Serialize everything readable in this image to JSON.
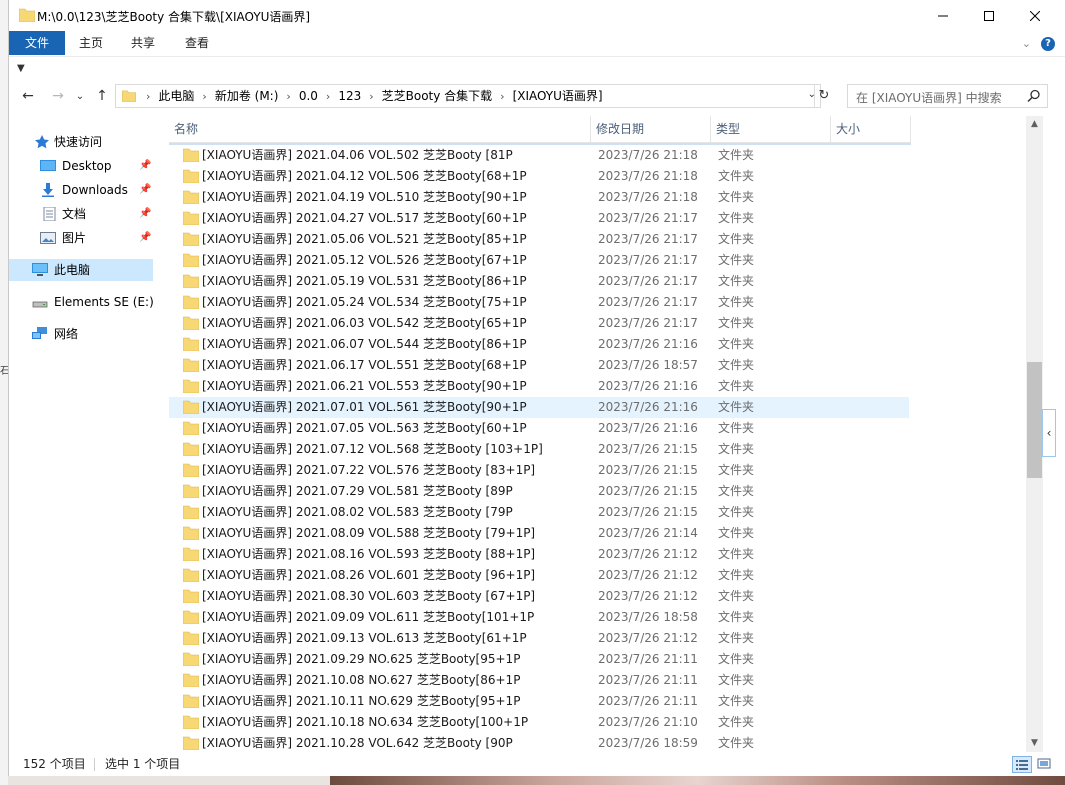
{
  "window": {
    "title": "M:\\0.0\\123\\芝芝Booty 合集下载\\[XIAOYU语画界]",
    "controls": {
      "minimize": "minimize",
      "maximize": "maximize",
      "close": "close"
    }
  },
  "ribbon": {
    "tabs": [
      "文件",
      "主页",
      "共享",
      "查看"
    ],
    "help": "?"
  },
  "address": {
    "crumbs": [
      "此电脑",
      "新加卷 (M:)",
      "0.0",
      "123",
      "芝芝Booty 合集下载",
      "[XIAOYU语画界]"
    ]
  },
  "search": {
    "placeholder": "在 [XIAOYU语画界] 中搜索"
  },
  "sidebar": {
    "items": [
      {
        "label": "快速访问",
        "icon": "star-icon"
      },
      {
        "label": "Desktop",
        "icon": "desktop-icon",
        "pinned": true
      },
      {
        "label": "Downloads",
        "icon": "download-icon",
        "pinned": true
      },
      {
        "label": "文档",
        "icon": "document-icon",
        "pinned": true
      },
      {
        "label": "图片",
        "icon": "picture-icon",
        "pinned": true
      },
      {
        "label": "此电脑",
        "icon": "computer-icon",
        "selected": true
      },
      {
        "label": "Elements SE (E:)",
        "icon": "drive-icon"
      },
      {
        "label": "网络",
        "icon": "network-icon"
      }
    ]
  },
  "columns": {
    "name": "名称",
    "date": "修改日期",
    "type": "类型",
    "size": "大小"
  },
  "files": [
    {
      "name": "[XIAOYU语画界] 2021.04.06 VOL.502 芝芝Booty [81P",
      "date": "2023/7/26 21:18",
      "type": "文件夹"
    },
    {
      "name": "[XIAOYU语画界] 2021.04.12 VOL.506 芝芝Booty[68+1P",
      "date": "2023/7/26 21:18",
      "type": "文件夹"
    },
    {
      "name": "[XIAOYU语画界] 2021.04.19 VOL.510 芝芝Booty[90+1P",
      "date": "2023/7/26 21:18",
      "type": "文件夹"
    },
    {
      "name": "[XIAOYU语画界] 2021.04.27 VOL.517 芝芝Booty[60+1P",
      "date": "2023/7/26 21:17",
      "type": "文件夹"
    },
    {
      "name": "[XIAOYU语画界] 2021.05.06 VOL.521 芝芝Booty[85+1P",
      "date": "2023/7/26 21:17",
      "type": "文件夹"
    },
    {
      "name": "[XIAOYU语画界] 2021.05.12 VOL.526 芝芝Booty[67+1P",
      "date": "2023/7/26 21:17",
      "type": "文件夹"
    },
    {
      "name": "[XIAOYU语画界] 2021.05.19 VOL.531 芝芝Booty[86+1P",
      "date": "2023/7/26 21:17",
      "type": "文件夹"
    },
    {
      "name": "[XIAOYU语画界] 2021.05.24 VOL.534 芝芝Booty[75+1P",
      "date": "2023/7/26 21:17",
      "type": "文件夹"
    },
    {
      "name": "[XIAOYU语画界] 2021.06.03 VOL.542 芝芝Booty[65+1P",
      "date": "2023/7/26 21:17",
      "type": "文件夹"
    },
    {
      "name": "[XIAOYU语画界] 2021.06.07 VOL.544 芝芝Booty[86+1P",
      "date": "2023/7/26 21:16",
      "type": "文件夹"
    },
    {
      "name": "[XIAOYU语画界] 2021.06.17 VOL.551 芝芝Booty[68+1P",
      "date": "2023/7/26 18:57",
      "type": "文件夹"
    },
    {
      "name": "[XIAOYU语画界] 2021.06.21 VOL.553 芝芝Booty[90+1P",
      "date": "2023/7/26 21:16",
      "type": "文件夹"
    },
    {
      "name": "[XIAOYU语画界] 2021.07.01 VOL.561 芝芝Booty[90+1P",
      "date": "2023/7/26 21:16",
      "type": "文件夹",
      "selected": true
    },
    {
      "name": "[XIAOYU语画界] 2021.07.05 VOL.563 芝芝Booty[60+1P",
      "date": "2023/7/26 21:16",
      "type": "文件夹"
    },
    {
      "name": "[XIAOYU语画界] 2021.07.12 VOL.568 芝芝Booty [103+1P]",
      "date": "2023/7/26 21:15",
      "type": "文件夹"
    },
    {
      "name": "[XIAOYU语画界] 2021.07.22 VOL.576 芝芝Booty [83+1P]",
      "date": "2023/7/26 21:15",
      "type": "文件夹"
    },
    {
      "name": "[XIAOYU语画界] 2021.07.29 VOL.581 芝芝Booty [89P",
      "date": "2023/7/26 21:15",
      "type": "文件夹"
    },
    {
      "name": "[XIAOYU语画界] 2021.08.02 VOL.583 芝芝Booty [79P",
      "date": "2023/7/26 21:15",
      "type": "文件夹"
    },
    {
      "name": "[XIAOYU语画界] 2021.08.09 VOL.588 芝芝Booty [79+1P]",
      "date": "2023/7/26 21:14",
      "type": "文件夹"
    },
    {
      "name": "[XIAOYU语画界] 2021.08.16 VOL.593 芝芝Booty [88+1P]",
      "date": "2023/7/26 21:12",
      "type": "文件夹"
    },
    {
      "name": "[XIAOYU语画界] 2021.08.26 VOL.601 芝芝Booty [96+1P]",
      "date": "2023/7/26 21:12",
      "type": "文件夹"
    },
    {
      "name": "[XIAOYU语画界] 2021.08.30 VOL.603 芝芝Booty [67+1P]",
      "date": "2023/7/26 21:12",
      "type": "文件夹"
    },
    {
      "name": "[XIAOYU语画界] 2021.09.09 VOL.611 芝芝Booty[101+1P",
      "date": "2023/7/26 18:58",
      "type": "文件夹"
    },
    {
      "name": "[XIAOYU语画界] 2021.09.13 VOL.613 芝芝Booty[61+1P",
      "date": "2023/7/26 21:12",
      "type": "文件夹"
    },
    {
      "name": "[XIAOYU语画界] 2021.09.29 NO.625 芝芝Booty[95+1P",
      "date": "2023/7/26 21:11",
      "type": "文件夹"
    },
    {
      "name": "[XIAOYU语画界] 2021.10.08 NO.627 芝芝Booty[86+1P",
      "date": "2023/7/26 21:11",
      "type": "文件夹"
    },
    {
      "name": "[XIAOYU语画界] 2021.10.11 NO.629 芝芝Booty[95+1P",
      "date": "2023/7/26 21:11",
      "type": "文件夹"
    },
    {
      "name": "[XIAOYU语画界] 2021.10.18 NO.634 芝芝Booty[100+1P",
      "date": "2023/7/26 21:10",
      "type": "文件夹"
    },
    {
      "name": "[XIAOYU语画界] 2021.10.28 VOL.642 芝芝Booty [90P",
      "date": "2023/7/26 18:59",
      "type": "文件夹"
    }
  ],
  "status": {
    "count": "152 个项目",
    "selection": "选中 1 个项目"
  },
  "colors": {
    "accent": "#1a64b4",
    "folder": "#f8d775",
    "selected_row": "#e5f3ff",
    "selected_nav": "#cce8ff"
  }
}
